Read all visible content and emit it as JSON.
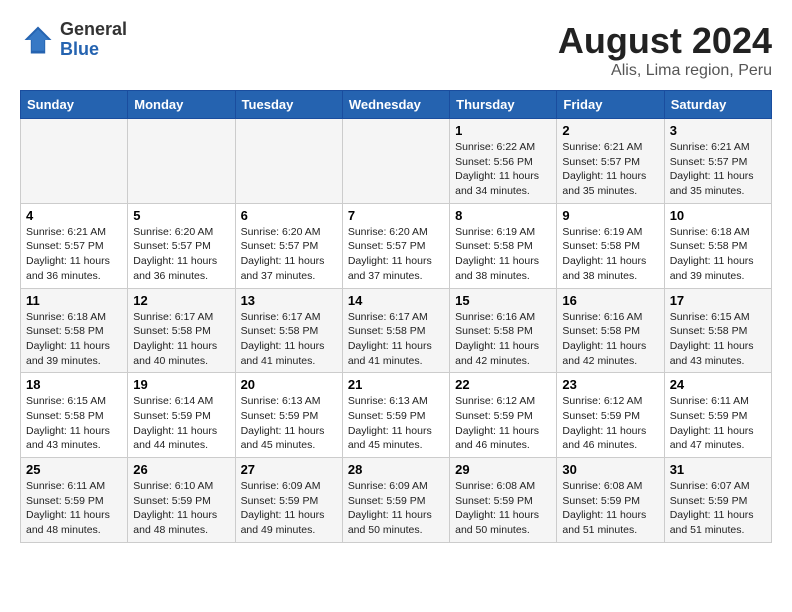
{
  "header": {
    "logo_general": "General",
    "logo_blue": "Blue",
    "main_title": "August 2024",
    "subtitle": "Alis, Lima region, Peru"
  },
  "days_of_week": [
    "Sunday",
    "Monday",
    "Tuesday",
    "Wednesday",
    "Thursday",
    "Friday",
    "Saturday"
  ],
  "weeks": [
    [
      {
        "day": "",
        "info": ""
      },
      {
        "day": "",
        "info": ""
      },
      {
        "day": "",
        "info": ""
      },
      {
        "day": "",
        "info": ""
      },
      {
        "day": "1",
        "info": "Sunrise: 6:22 AM\nSunset: 5:56 PM\nDaylight: 11 hours\nand 34 minutes."
      },
      {
        "day": "2",
        "info": "Sunrise: 6:21 AM\nSunset: 5:57 PM\nDaylight: 11 hours\nand 35 minutes."
      },
      {
        "day": "3",
        "info": "Sunrise: 6:21 AM\nSunset: 5:57 PM\nDaylight: 11 hours\nand 35 minutes."
      }
    ],
    [
      {
        "day": "4",
        "info": "Sunrise: 6:21 AM\nSunset: 5:57 PM\nDaylight: 11 hours\nand 36 minutes."
      },
      {
        "day": "5",
        "info": "Sunrise: 6:20 AM\nSunset: 5:57 PM\nDaylight: 11 hours\nand 36 minutes."
      },
      {
        "day": "6",
        "info": "Sunrise: 6:20 AM\nSunset: 5:57 PM\nDaylight: 11 hours\nand 37 minutes."
      },
      {
        "day": "7",
        "info": "Sunrise: 6:20 AM\nSunset: 5:57 PM\nDaylight: 11 hours\nand 37 minutes."
      },
      {
        "day": "8",
        "info": "Sunrise: 6:19 AM\nSunset: 5:58 PM\nDaylight: 11 hours\nand 38 minutes."
      },
      {
        "day": "9",
        "info": "Sunrise: 6:19 AM\nSunset: 5:58 PM\nDaylight: 11 hours\nand 38 minutes."
      },
      {
        "day": "10",
        "info": "Sunrise: 6:18 AM\nSunset: 5:58 PM\nDaylight: 11 hours\nand 39 minutes."
      }
    ],
    [
      {
        "day": "11",
        "info": "Sunrise: 6:18 AM\nSunset: 5:58 PM\nDaylight: 11 hours\nand 39 minutes."
      },
      {
        "day": "12",
        "info": "Sunrise: 6:17 AM\nSunset: 5:58 PM\nDaylight: 11 hours\nand 40 minutes."
      },
      {
        "day": "13",
        "info": "Sunrise: 6:17 AM\nSunset: 5:58 PM\nDaylight: 11 hours\nand 41 minutes."
      },
      {
        "day": "14",
        "info": "Sunrise: 6:17 AM\nSunset: 5:58 PM\nDaylight: 11 hours\nand 41 minutes."
      },
      {
        "day": "15",
        "info": "Sunrise: 6:16 AM\nSunset: 5:58 PM\nDaylight: 11 hours\nand 42 minutes."
      },
      {
        "day": "16",
        "info": "Sunrise: 6:16 AM\nSunset: 5:58 PM\nDaylight: 11 hours\nand 42 minutes."
      },
      {
        "day": "17",
        "info": "Sunrise: 6:15 AM\nSunset: 5:58 PM\nDaylight: 11 hours\nand 43 minutes."
      }
    ],
    [
      {
        "day": "18",
        "info": "Sunrise: 6:15 AM\nSunset: 5:58 PM\nDaylight: 11 hours\nand 43 minutes."
      },
      {
        "day": "19",
        "info": "Sunrise: 6:14 AM\nSunset: 5:59 PM\nDaylight: 11 hours\nand 44 minutes."
      },
      {
        "day": "20",
        "info": "Sunrise: 6:13 AM\nSunset: 5:59 PM\nDaylight: 11 hours\nand 45 minutes."
      },
      {
        "day": "21",
        "info": "Sunrise: 6:13 AM\nSunset: 5:59 PM\nDaylight: 11 hours\nand 45 minutes."
      },
      {
        "day": "22",
        "info": "Sunrise: 6:12 AM\nSunset: 5:59 PM\nDaylight: 11 hours\nand 46 minutes."
      },
      {
        "day": "23",
        "info": "Sunrise: 6:12 AM\nSunset: 5:59 PM\nDaylight: 11 hours\nand 46 minutes."
      },
      {
        "day": "24",
        "info": "Sunrise: 6:11 AM\nSunset: 5:59 PM\nDaylight: 11 hours\nand 47 minutes."
      }
    ],
    [
      {
        "day": "25",
        "info": "Sunrise: 6:11 AM\nSunset: 5:59 PM\nDaylight: 11 hours\nand 48 minutes."
      },
      {
        "day": "26",
        "info": "Sunrise: 6:10 AM\nSunset: 5:59 PM\nDaylight: 11 hours\nand 48 minutes."
      },
      {
        "day": "27",
        "info": "Sunrise: 6:09 AM\nSunset: 5:59 PM\nDaylight: 11 hours\nand 49 minutes."
      },
      {
        "day": "28",
        "info": "Sunrise: 6:09 AM\nSunset: 5:59 PM\nDaylight: 11 hours\nand 50 minutes."
      },
      {
        "day": "29",
        "info": "Sunrise: 6:08 AM\nSunset: 5:59 PM\nDaylight: 11 hours\nand 50 minutes."
      },
      {
        "day": "30",
        "info": "Sunrise: 6:08 AM\nSunset: 5:59 PM\nDaylight: 11 hours\nand 51 minutes."
      },
      {
        "day": "31",
        "info": "Sunrise: 6:07 AM\nSunset: 5:59 PM\nDaylight: 11 hours\nand 51 minutes."
      }
    ]
  ]
}
